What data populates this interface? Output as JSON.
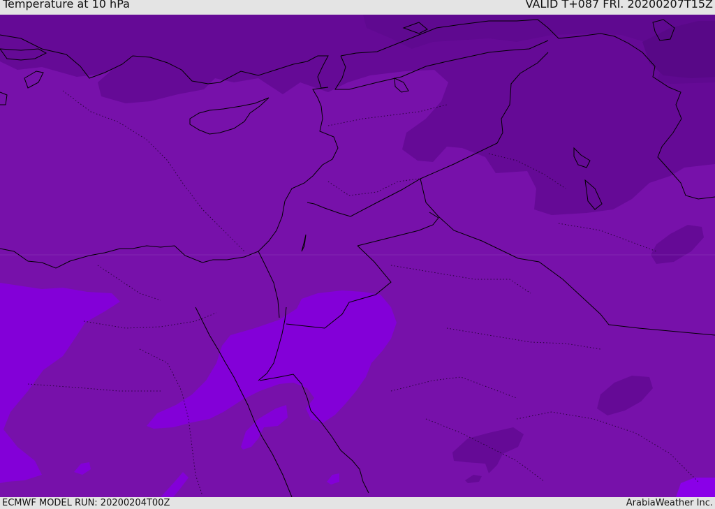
{
  "header": {
    "title": "Temperature at 10 hPa",
    "valid": "VALID T+087 FRI. 20200207T15Z"
  },
  "footer": {
    "model_run": "ECMWF MODEL RUN: 20200204T00Z",
    "credit": "ArabiaWeather Inc."
  },
  "colors": {
    "darkest": "#5a0888",
    "dark": "#650a96",
    "mid": "#6e0c9f",
    "base": "#7711aa",
    "light": "#8300d8",
    "lightest": "#8a00e8",
    "coast": "#000000"
  }
}
